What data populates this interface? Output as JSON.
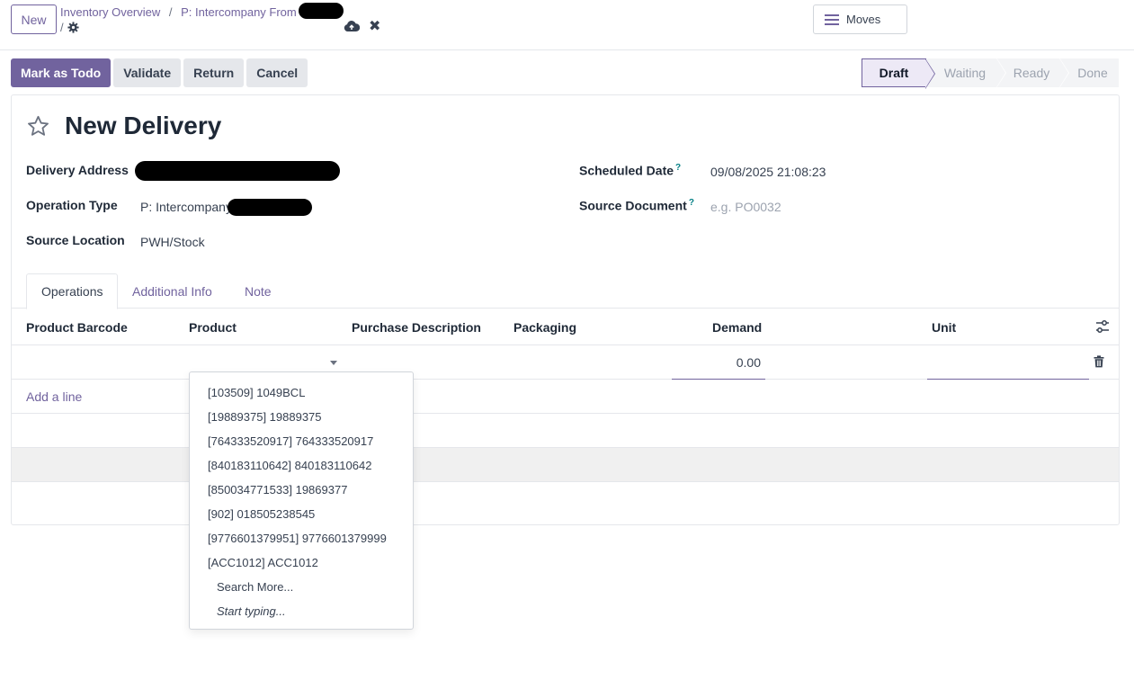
{
  "topbar": {
    "new_label": "New",
    "breadcrumbs": [
      "Inventory Overview",
      "P: Intercompany From"
    ],
    "breadcrumb_sep": "/",
    "sub_sep": "/",
    "moves_label": "Moves"
  },
  "actions": {
    "mark_todo": "Mark as Todo",
    "validate": "Validate",
    "return": "Return",
    "cancel": "Cancel"
  },
  "status": {
    "stages": [
      "Draft",
      "Waiting",
      "Ready",
      "Done"
    ],
    "current": "Draft"
  },
  "form": {
    "title": "New Delivery",
    "fields": {
      "delivery_address_label": "Delivery Address",
      "operation_type_label": "Operation Type",
      "operation_type_value": "P: Intercompany",
      "source_location_label": "Source Location",
      "source_location_value": "PWH/Stock",
      "scheduled_date_label": "Scheduled Date",
      "scheduled_date_value": "09/08/2025 21:08:23",
      "source_document_label": "Source Document",
      "source_document_placeholder": "e.g. PO0032",
      "help_mark": "?"
    }
  },
  "tabs": [
    "Operations",
    "Additional Info",
    "Note"
  ],
  "table": {
    "headers": [
      "Product Barcode",
      "Product",
      "Purchase Description",
      "Packaging",
      "Demand",
      "Unit"
    ],
    "edit_row": {
      "demand": "0.00"
    },
    "add_line": "Add a line"
  },
  "dropdown": {
    "items": [
      "[103509] 1049BCL",
      "[19889375] 19889375",
      "[764333520917] 764333520917",
      "[840183110642] 840183110642",
      "[850034771533] 19869377",
      "[902] 018505238545",
      "[9776601379951] 9776601379999",
      "[ACC1012] ACC1012"
    ],
    "search_more": "Search More...",
    "start_typing": "Start typing..."
  },
  "colors": {
    "accent": "#71639e",
    "secondary_button": "#e5e7eb",
    "help": "#017e84"
  }
}
